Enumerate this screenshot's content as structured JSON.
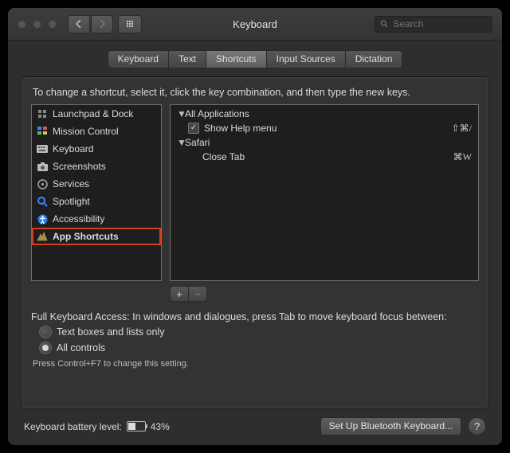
{
  "titlebar": {
    "title": "Keyboard",
    "search_placeholder": "Search"
  },
  "tabs": [
    "Keyboard",
    "Text",
    "Shortcuts",
    "Input Sources",
    "Dictation"
  ],
  "active_tab_index": 2,
  "instruction": "To change a shortcut, select it, click the key combination, and then type the new keys.",
  "sidebar": {
    "items": [
      {
        "label": "Launchpad & Dock",
        "icon": "launchpad-icon",
        "color": "#9a9a9a"
      },
      {
        "label": "Mission Control",
        "icon": "mission-control-icon",
        "color": "#4aa3ff"
      },
      {
        "label": "Keyboard",
        "icon": "keyboard-icon",
        "color": "#bcbcbc"
      },
      {
        "label": "Screenshots",
        "icon": "screenshots-icon",
        "color": "#bcbcbc"
      },
      {
        "label": "Services",
        "icon": "services-icon",
        "color": "#8e8e8e"
      },
      {
        "label": "Spotlight",
        "icon": "spotlight-icon",
        "color": "#3b86ff"
      },
      {
        "label": "Accessibility",
        "icon": "accessibility-icon",
        "color": "#1b82ff"
      },
      {
        "label": "App Shortcuts",
        "icon": "app-shortcuts-icon",
        "color": "#c7a75a"
      }
    ],
    "selected_index": 7
  },
  "right": {
    "groups": [
      {
        "name": "All Applications",
        "expanded": true,
        "items": [
          {
            "label": "Show Help menu",
            "enabled": true,
            "shortcut": "⇧⌘/"
          }
        ]
      },
      {
        "name": "Safari",
        "expanded": true,
        "items": [
          {
            "label": "Close Tab",
            "enabled": null,
            "shortcut": "⌘W"
          }
        ]
      }
    ]
  },
  "buttons": {
    "add": "+",
    "remove": "−"
  },
  "fka": {
    "label": "Full Keyboard Access: In windows and dialogues, press Tab to move keyboard focus between:",
    "options": [
      "Text boxes and lists only",
      "All controls"
    ],
    "selected": 1,
    "hint": "Press Control+F7 to change this setting."
  },
  "footer": {
    "battery_label": "Keyboard battery level:",
    "battery_percent": "43%",
    "bluetooth_button": "Set Up Bluetooth Keyboard...",
    "help": "?"
  }
}
